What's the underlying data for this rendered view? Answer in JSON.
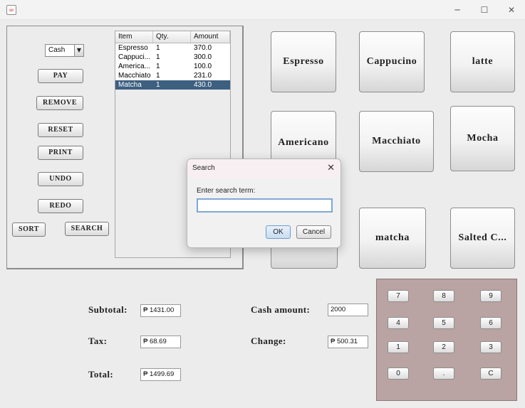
{
  "window": {
    "app_icon": "java-icon",
    "minimize": "─",
    "maximize": "☐",
    "close": "✕"
  },
  "controls": {
    "payment_method": "Cash",
    "buttons": {
      "pay": "PAY",
      "remove": "REMOVE",
      "reset": "RESET",
      "print": "PRINT",
      "undo": "UNDO",
      "redo": "REDO",
      "sort": "SORT",
      "search": "SEARCH"
    }
  },
  "order_table": {
    "columns": [
      "Item",
      "Qty.",
      "Amount"
    ],
    "rows": [
      {
        "item": "Espresso",
        "qty": "1",
        "amount": "370.0"
      },
      {
        "item": "Cappuci...",
        "qty": "1",
        "amount": "300.0"
      },
      {
        "item": "America...",
        "qty": "1",
        "amount": "100.0"
      },
      {
        "item": "Macchiato",
        "qty": "1",
        "amount": "231.0"
      },
      {
        "item": "Matcha",
        "qty": "1",
        "amount": "430.0"
      }
    ],
    "selected_row": 4
  },
  "products": [
    "Espresso",
    "Cappucino",
    "latte",
    "Americano",
    "Macchiato",
    "Mocha",
    "matcha",
    "Salted C..."
  ],
  "totals": {
    "subtotal_label": "Subtotal:",
    "subtotal_value": "₱ 1431.00",
    "tax_label": "Tax:",
    "tax_value": "₱ 68.69",
    "total_label": "Total:",
    "total_value": "₱ 1499.69",
    "cash_label": "Cash amount:",
    "cash_value": "2000",
    "change_label": "Change:",
    "change_value": "₱ 500.31"
  },
  "keypad": {
    "keys": [
      "7",
      "8",
      "9",
      "4",
      "5",
      "6",
      "1",
      "2",
      "3",
      "0",
      ".",
      "C"
    ],
    "background": "#b9a3a3"
  },
  "search_dialog": {
    "title": "Search",
    "close": "✕",
    "prompt": "Enter search term:",
    "input_value": "",
    "ok": "OK",
    "cancel": "Cancel"
  },
  "colors": {
    "selection": "#3d5f80",
    "dialog_title_bg": "#f8eff2",
    "input_focus": "#7fa8d6"
  }
}
